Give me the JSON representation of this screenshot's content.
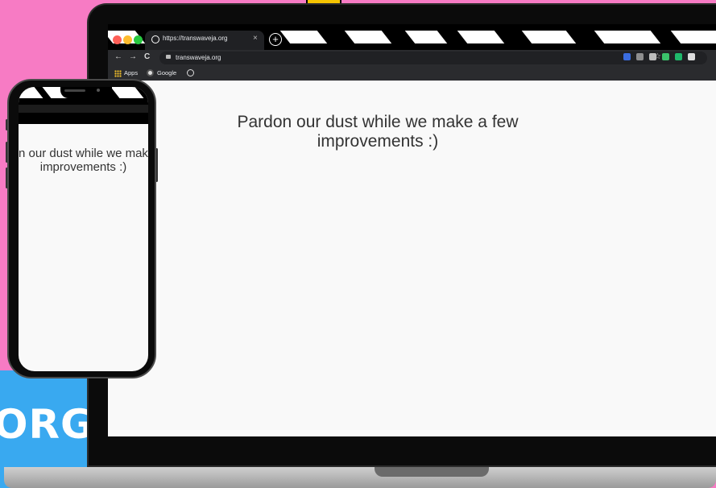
{
  "browser": {
    "tab_title": "https://transwaveja.org",
    "tab_close": "×",
    "new_tab": "+",
    "address": "transwaveja.org",
    "nav": {
      "back": "←",
      "forward": "→",
      "reload": "C"
    },
    "star": "☆",
    "bookmarks": [
      {
        "label": "Apps"
      },
      {
        "label": "Google"
      }
    ],
    "traffic_lights": {
      "close": "#ff5f57",
      "minimize": "#febc2e",
      "maximize": "#28c840"
    },
    "extensions": [
      "#3b6de0",
      "#8e8e8e",
      "#bdbdbd",
      "#3bc16b",
      "#1fb86b",
      "#dddddd"
    ]
  },
  "page": {
    "message_line1": "Pardon our dust while we make a few",
    "message_line2": "improvements :)"
  },
  "phone": {
    "message_line1": "Pardon our dust while we make a few",
    "message_line2": "improvements :)"
  },
  "brand": {
    "text": "ORG"
  }
}
